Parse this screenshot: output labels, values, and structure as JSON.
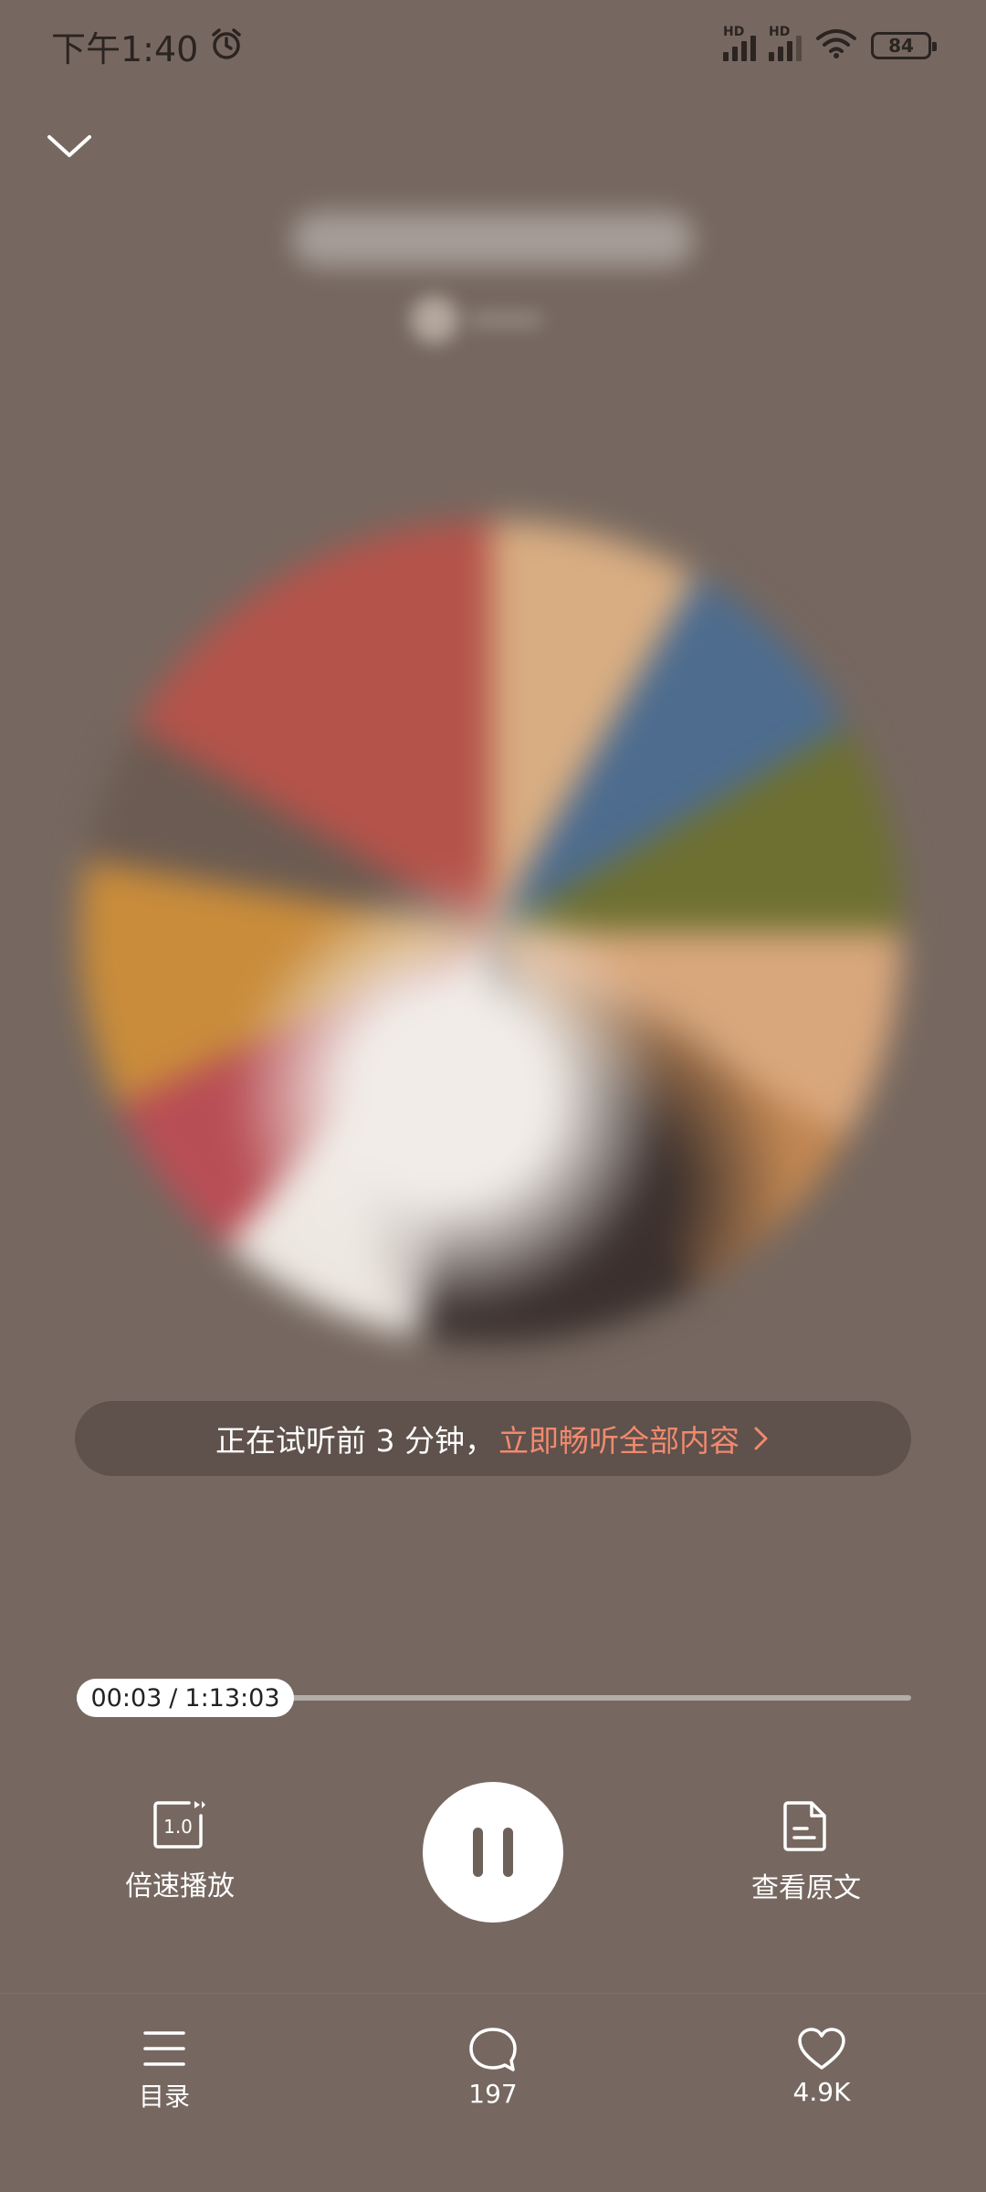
{
  "status_bar": {
    "time": "下午1:40",
    "signal_1_label": "HD",
    "signal_2_label": "HD",
    "battery": "84"
  },
  "trial_banner": {
    "text": "正在试听前 3 分钟，",
    "link": "立即畅听全部内容"
  },
  "progress": {
    "current": "00:03",
    "separator": "/",
    "total": "1:13:03",
    "fraction": 0.0007
  },
  "controls": {
    "speed_icon_text": "1.0",
    "speed_label": "倍速播放",
    "original_label": "查看原文"
  },
  "bottom_bar": {
    "toc_label": "目录",
    "comments_count": "197",
    "likes_count": "4.9K"
  },
  "colors": {
    "background": "#766860",
    "accent_link": "#f08a6f"
  }
}
